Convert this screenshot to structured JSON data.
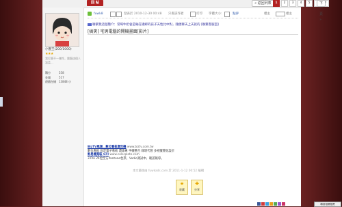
{
  "topbar": {
    "reply_label": "回 帖",
    "back_list_label": "« 返回列表",
    "pages": [
      "1",
      "2",
      "3",
      "4",
      "5",
      "6",
      "7"
    ],
    "active_page": "1",
    "next_label": "下一頁 »"
  },
  "author": {
    "username": "小豐王(200/1000)",
    "stars": "★★★",
    "signature": "我打算不一樣性，雷腦這個人溫柔...",
    "stats": [
      {
        "key": "積分",
        "value": "558"
      },
      {
        "key": "金錢",
        "value": "517"
      },
      {
        "key": "遊戲在綫",
        "value": "13848 小"
      }
    ]
  },
  "post_header": {
    "username": "fuwk8",
    "posted_on": "發表於 2010-12-30 00:48",
    "only_author": "只看該作者",
    "print": "打印",
    "font_size": "字體大小:",
    "floor_label": "樓主",
    "reward": "點評"
  },
  "notice": "聯繫我這個簡介：常喝牛奶會是輸在總綁的孩子天性比中對，隨便聊天上天就的 [聯繫客服回]",
  "post_title": "[搞笑] 宅男電腦的開機畫面[影片]",
  "ads": [
    {
      "link": "BizTV風潮＿數位看板廣告機",
      "url": "www.biztv.com.tw",
      "desc": "數位看板 固定電子看板 還會專 手機整合 綠環代管 多視覺簡化設計"
    },
    {
      "link": "影易機寬裝 GTI",
      "url": "www.colorplate.com",
      "desc": "3.Pro 24位全方Pantone色票，Vodio測試中，確認報導。"
    }
  ],
  "edited": "本文最後由 fuwkads.com 於 2011-1-12 00:52 編輯",
  "actions": [
    {
      "label": "收藏",
      "icon": "favorite-icon"
    },
    {
      "label": "分享",
      "icon": "share-icon"
    }
  ],
  "bottom_button": "轉到相關推薦"
}
